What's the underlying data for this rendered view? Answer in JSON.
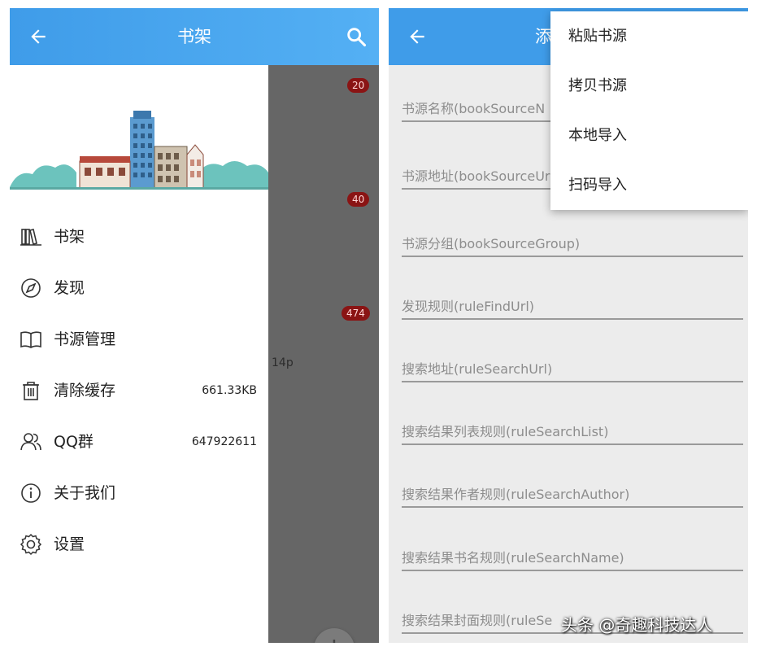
{
  "left_screen": {
    "appbar": {
      "title": "书架"
    },
    "badges": [
      "20",
      "40",
      "474"
    ],
    "partial_text": "14p",
    "fab_symbol": "+",
    "drawer": {
      "items": [
        {
          "label": "书架",
          "icon": "bookshelf-icon",
          "value": ""
        },
        {
          "label": "发现",
          "icon": "compass-icon",
          "value": ""
        },
        {
          "label": "书源管理",
          "icon": "open-book-icon",
          "value": ""
        },
        {
          "label": "清除缓存",
          "icon": "trash-icon",
          "value": "661.33KB"
        },
        {
          "label": "QQ群",
          "icon": "group-icon",
          "value": "647922611"
        },
        {
          "label": "关于我们",
          "icon": "info-icon",
          "value": ""
        },
        {
          "label": "设置",
          "icon": "gear-icon",
          "value": ""
        }
      ]
    }
  },
  "right_screen": {
    "appbar": {
      "title": "添"
    },
    "fields": [
      "书源名称(bookSourceN",
      "书源地址(bookSourceUr",
      "书源分组(bookSourceGroup)",
      "发现规则(ruleFindUrl)",
      "搜索地址(ruleSearchUrl)",
      "搜索结果列表规则(ruleSearchList)",
      "搜索结果作者规则(ruleSearchAuthor)",
      "搜索结果书名规则(ruleSearchName)",
      "搜索结果封面规则(ruleSe"
    ],
    "popup_menu": [
      "粘贴书源",
      "拷贝书源",
      "本地导入",
      "扫码导入"
    ]
  },
  "watermark": "头条 @奇趣科技达人",
  "colors": {
    "appbar": "#3f9ce9",
    "badge": "#8a1414",
    "scrim": "#666666",
    "form_bg": "#ececec"
  }
}
